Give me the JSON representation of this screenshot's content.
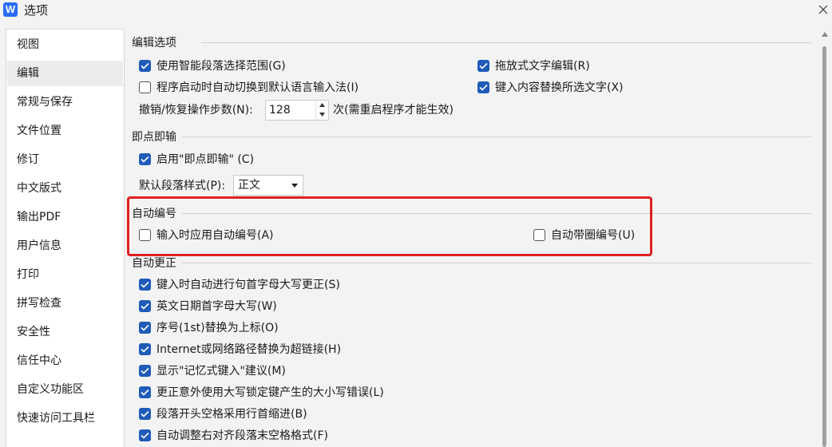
{
  "window": {
    "logo": "W",
    "title": "选项"
  },
  "sidebar": {
    "items": [
      {
        "label": "视图"
      },
      {
        "label": "编辑"
      },
      {
        "label": "常规与保存"
      },
      {
        "label": "文件位置"
      },
      {
        "label": "修订"
      },
      {
        "label": "中文版式"
      },
      {
        "label": "输出PDF"
      },
      {
        "label": "用户信息"
      },
      {
        "label": "打印"
      },
      {
        "label": "拼写检查"
      },
      {
        "label": "安全性"
      },
      {
        "label": "信任中心"
      },
      {
        "label": "自定义功能区"
      },
      {
        "label": "快速访问工具栏"
      }
    ],
    "active": "编辑"
  },
  "sections": {
    "edit": {
      "title": "编辑选项",
      "smart_select": {
        "label": "使用智能段落选择范围(G)",
        "checked": true
      },
      "auto_ime": {
        "label": "程序启动时自动切换到默认语言输入法(I)",
        "checked": false
      },
      "drag_edit": {
        "label": "拖放式文字编辑(R)",
        "checked": true
      },
      "replace_select": {
        "label": "键入内容替换所选文字(X)",
        "checked": true
      },
      "undo_label": "撤销/恢复操作步数(N):",
      "undo_value": "128",
      "undo_note": "次(需重启程序才能生效)"
    },
    "click_type": {
      "title": "即点即输",
      "enable": {
        "label": "启用\"即点即输\" (C)",
        "checked": true
      },
      "style_label": "默认段落样式(P):",
      "style_value": "正文"
    },
    "auto_number": {
      "title": "自动编号",
      "apply_on_type": {
        "label": "输入时应用自动编号(A)",
        "checked": false
      },
      "circled": {
        "label": "自动带圈编号(U)",
        "checked": false
      }
    },
    "autocorrect": {
      "title": "自动更正",
      "items": [
        {
          "label": "键入时自动进行句首字母大写更正(S)",
          "checked": true
        },
        {
          "label": "英文日期首字母大写(W)",
          "checked": true
        },
        {
          "label": "序号(1st)替换为上标(O)",
          "checked": true
        },
        {
          "label": "Internet或网络路径替换为超链接(H)",
          "checked": true
        },
        {
          "label": "显示\"记忆式键入\"建议(M)",
          "checked": true
        },
        {
          "label": "更正意外使用大写锁定键产生的大小写错误(L)",
          "checked": true
        },
        {
          "label": "段落开头空格采用行首缩进(B)",
          "checked": true
        },
        {
          "label": "自动调整右对齐段落末空格格式(F)",
          "checked": true
        }
      ]
    }
  },
  "colors": {
    "accent": "#1f5bb8",
    "highlight": "#e02020"
  }
}
